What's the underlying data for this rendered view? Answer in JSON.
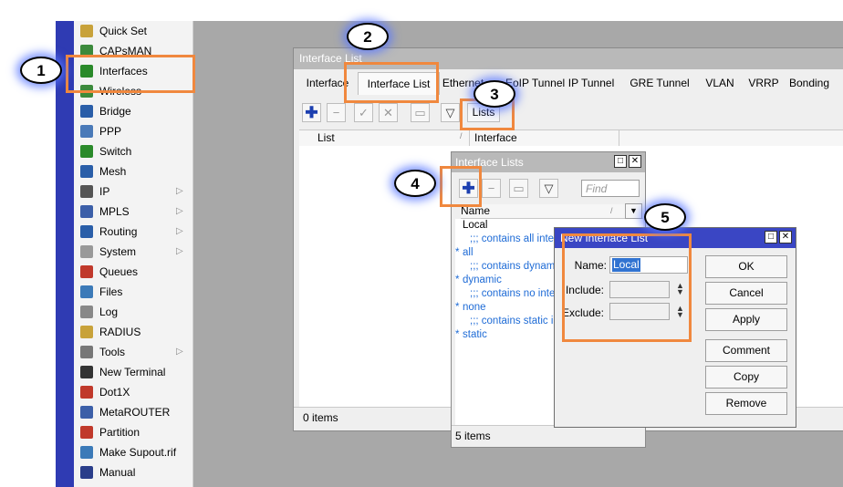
{
  "sidebar": {
    "items": [
      {
        "label": "Quick Set",
        "icon": "wand-icon",
        "arrow": ""
      },
      {
        "label": "CAPsMAN",
        "icon": "capsman-icon",
        "arrow": ""
      },
      {
        "label": "Interfaces",
        "icon": "interfaces-icon",
        "arrow": ""
      },
      {
        "label": "Wireless",
        "icon": "wireless-icon",
        "arrow": ""
      },
      {
        "label": "Bridge",
        "icon": "bridge-icon",
        "arrow": ""
      },
      {
        "label": "PPP",
        "icon": "ppp-icon",
        "arrow": ""
      },
      {
        "label": "Switch",
        "icon": "switch-icon",
        "arrow": ""
      },
      {
        "label": "Mesh",
        "icon": "mesh-icon",
        "arrow": ""
      },
      {
        "label": "IP",
        "icon": "ip-icon",
        "arrow": "▷"
      },
      {
        "label": "MPLS",
        "icon": "mpls-icon",
        "arrow": "▷"
      },
      {
        "label": "Routing",
        "icon": "routing-icon",
        "arrow": "▷"
      },
      {
        "label": "System",
        "icon": "system-gear-icon",
        "arrow": "▷"
      },
      {
        "label": "Queues",
        "icon": "queues-icon",
        "arrow": ""
      },
      {
        "label": "Files",
        "icon": "folder-icon",
        "arrow": ""
      },
      {
        "label": "Log",
        "icon": "log-icon",
        "arrow": ""
      },
      {
        "label": "RADIUS",
        "icon": "radius-icon",
        "arrow": ""
      },
      {
        "label": "Tools",
        "icon": "tools-icon",
        "arrow": "▷"
      },
      {
        "label": "New Terminal",
        "icon": "terminal-icon",
        "arrow": ""
      },
      {
        "label": "Dot1X",
        "icon": "dot1x-icon",
        "arrow": ""
      },
      {
        "label": "MetaROUTER",
        "icon": "metarouter-icon",
        "arrow": ""
      },
      {
        "label": "Partition",
        "icon": "partition-icon",
        "arrow": ""
      },
      {
        "label": "Make Supout.rif",
        "icon": "supout-icon",
        "arrow": ""
      },
      {
        "label": "Manual",
        "icon": "manual-icon",
        "arrow": ""
      }
    ]
  },
  "main_window": {
    "title": "Interface List",
    "tabs": [
      "Interface",
      "Interface List",
      "Ethernet",
      "EoIP Tunnel",
      "IP Tunnel",
      "GRE Tunnel",
      "VLAN",
      "VRRP",
      "Bonding"
    ],
    "toolbar": {
      "lists_label": "Lists"
    },
    "columns": [
      "List",
      "Interface"
    ],
    "status": "0 items"
  },
  "lists_dialog": {
    "title": "Interface Lists",
    "find_placeholder": "Find",
    "column": "Name",
    "rows": [
      {
        "marker": "",
        "text": "Local"
      },
      {
        "marker": "",
        "text": ";;; contains all interfaces"
      },
      {
        "marker": "*",
        "text": "all"
      },
      {
        "marker": "",
        "text": ";;; contains dynamic interfaces"
      },
      {
        "marker": "*",
        "text": "dynamic"
      },
      {
        "marker": "",
        "text": ";;; contains no interfaces"
      },
      {
        "marker": "*",
        "text": "none"
      },
      {
        "marker": "",
        "text": ";;; contains static interfaces"
      },
      {
        "marker": "*",
        "text": "static"
      }
    ],
    "status": "5 items"
  },
  "new_dialog": {
    "title": "New Interface List",
    "name_label": "Name:",
    "name_value": "Local",
    "include_label": "Include:",
    "exclude_label": "Exclude:",
    "buttons": [
      "OK",
      "Cancel",
      "Apply",
      "Comment",
      "Copy",
      "Remove"
    ]
  },
  "callouts": [
    "1",
    "2",
    "3",
    "4",
    "5"
  ],
  "colors": {
    "highlight": "#f0883e",
    "sidebar_strip": "#2f3bb3",
    "active_title": "#3a46c4",
    "workspace": "#a8a8a8"
  }
}
